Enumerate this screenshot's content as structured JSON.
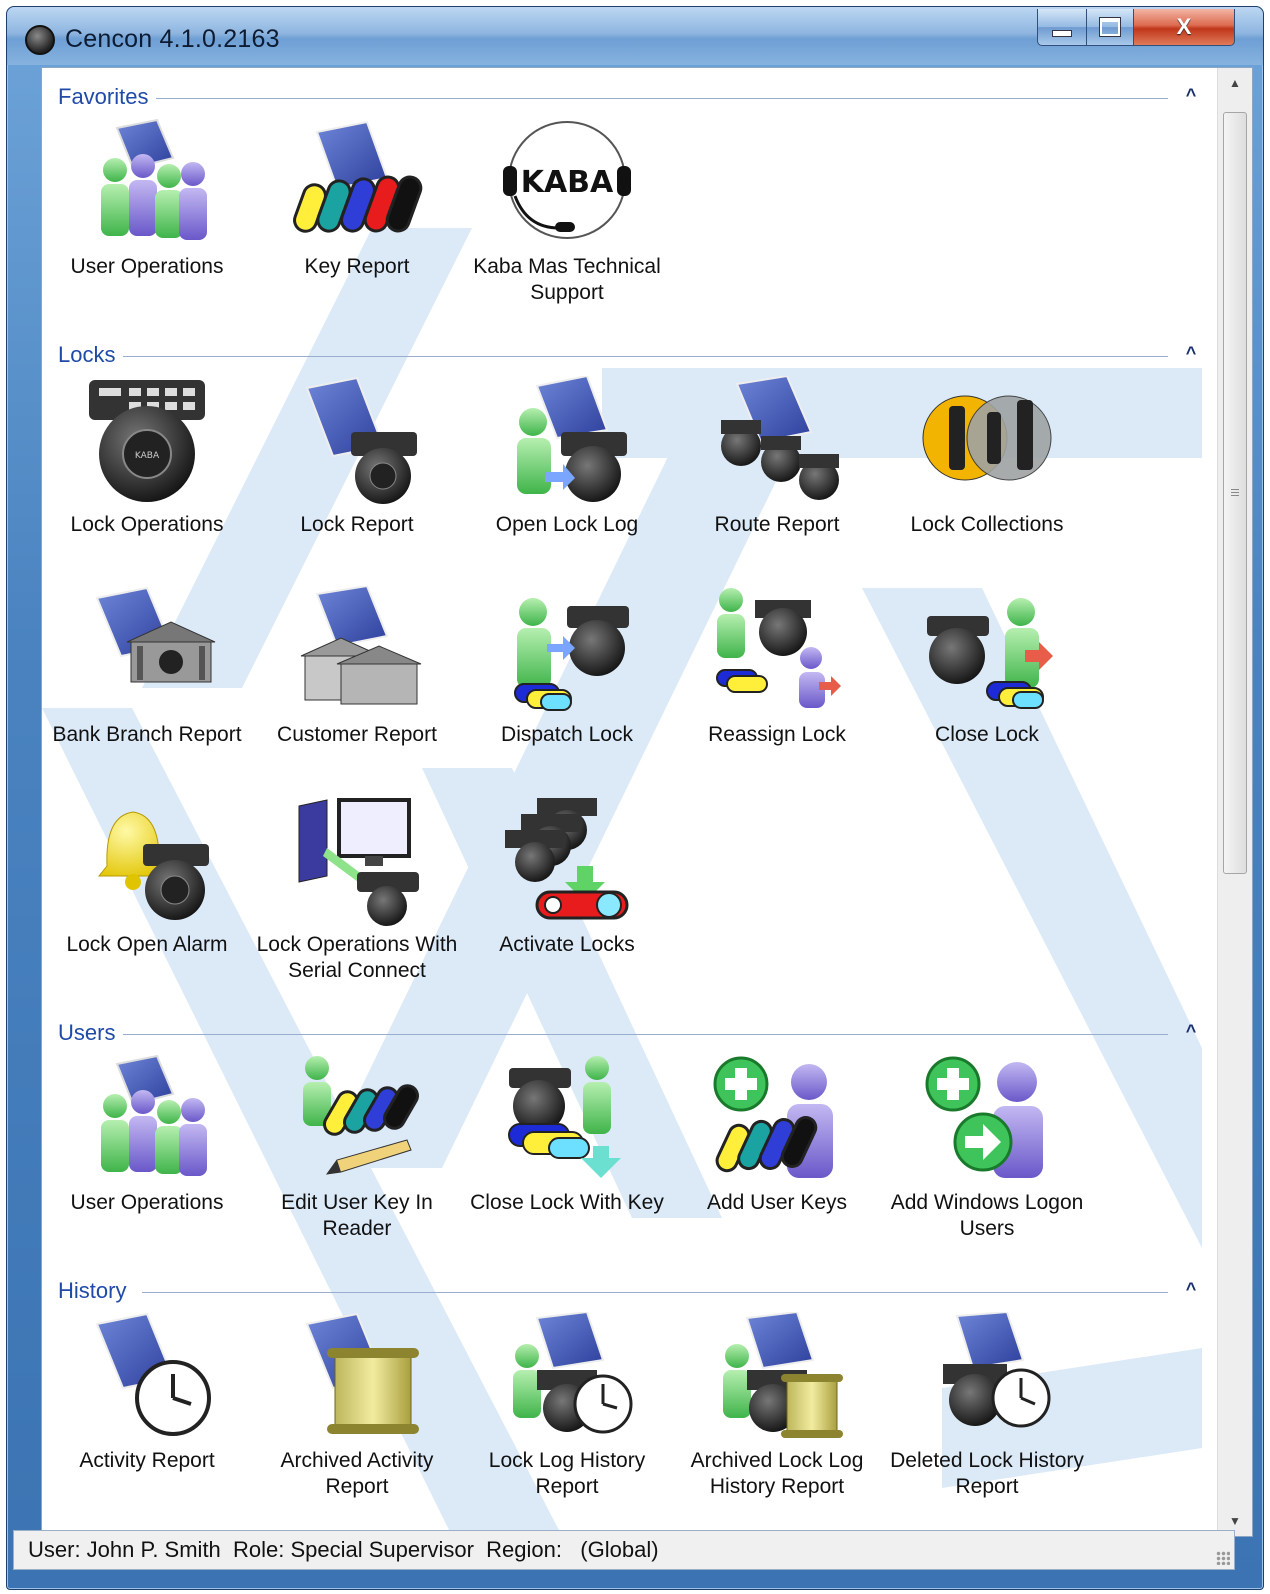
{
  "window": {
    "title": "Cencon 4.1.0.2163",
    "minimize_icon": "minimize-icon",
    "maximize_icon": "maximize-icon",
    "close_label": "X"
  },
  "colors": {
    "section_title": "#1f4aa8",
    "titlebar": "#8fb6e0",
    "watermark": "#cfe1f3"
  },
  "sections": {
    "favorites": {
      "title": "Favorites",
      "items": [
        {
          "label": "User Operations",
          "icon": "user-operations-icon"
        },
        {
          "label": "Key Report",
          "icon": "key-report-icon"
        },
        {
          "label": "Kaba Mas Technical Support",
          "icon": "kaba-support-headset-icon"
        }
      ]
    },
    "locks": {
      "title": "Locks",
      "items": [
        {
          "label": "Lock Operations",
          "icon": "lock-operations-icon"
        },
        {
          "label": "Lock Report",
          "icon": "lock-report-icon"
        },
        {
          "label": "Open Lock Log",
          "icon": "open-lock-log-icon"
        },
        {
          "label": "Route Report",
          "icon": "route-report-icon"
        },
        {
          "label": "Lock Collections",
          "icon": "lock-collections-icon"
        },
        {
          "label": "Bank Branch Report",
          "icon": "bank-branch-report-icon"
        },
        {
          "label": "Customer Report",
          "icon": "customer-report-icon"
        },
        {
          "label": "Dispatch Lock",
          "icon": "dispatch-lock-icon"
        },
        {
          "label": "Reassign Lock",
          "icon": "reassign-lock-icon"
        },
        {
          "label": "Close Lock",
          "icon": "close-lock-icon"
        },
        {
          "label": "Lock Open Alarm",
          "icon": "lock-open-alarm-icon"
        },
        {
          "label": "Lock Operations With Serial Connect",
          "icon": "serial-connect-icon"
        },
        {
          "label": "Activate Locks",
          "icon": "activate-locks-icon"
        }
      ]
    },
    "users": {
      "title": "Users",
      "items": [
        {
          "label": "User Operations",
          "icon": "user-operations-icon"
        },
        {
          "label": "Edit User Key In Reader",
          "icon": "edit-user-key-icon"
        },
        {
          "label": "Close Lock With Key",
          "icon": "close-lock-with-key-icon"
        },
        {
          "label": "Add User Keys",
          "icon": "add-user-keys-icon"
        },
        {
          "label": "Add Windows Logon Users",
          "icon": "add-windows-users-icon"
        }
      ]
    },
    "history": {
      "title": "History",
      "items": [
        {
          "label": "Activity Report",
          "icon": "activity-report-icon"
        },
        {
          "label": "Archived Activity Report",
          "icon": "archived-activity-icon"
        },
        {
          "label": "Lock Log History Report",
          "icon": "lock-log-history-icon"
        },
        {
          "label": "Archived Lock Log History Report",
          "icon": "archived-lock-log-icon"
        },
        {
          "label": "Deleted Lock History Report",
          "icon": "deleted-lock-history-icon"
        }
      ]
    }
  },
  "status": {
    "text": "User: John P. Smith  Role: Special Supervisor  Region:   (Global)"
  }
}
